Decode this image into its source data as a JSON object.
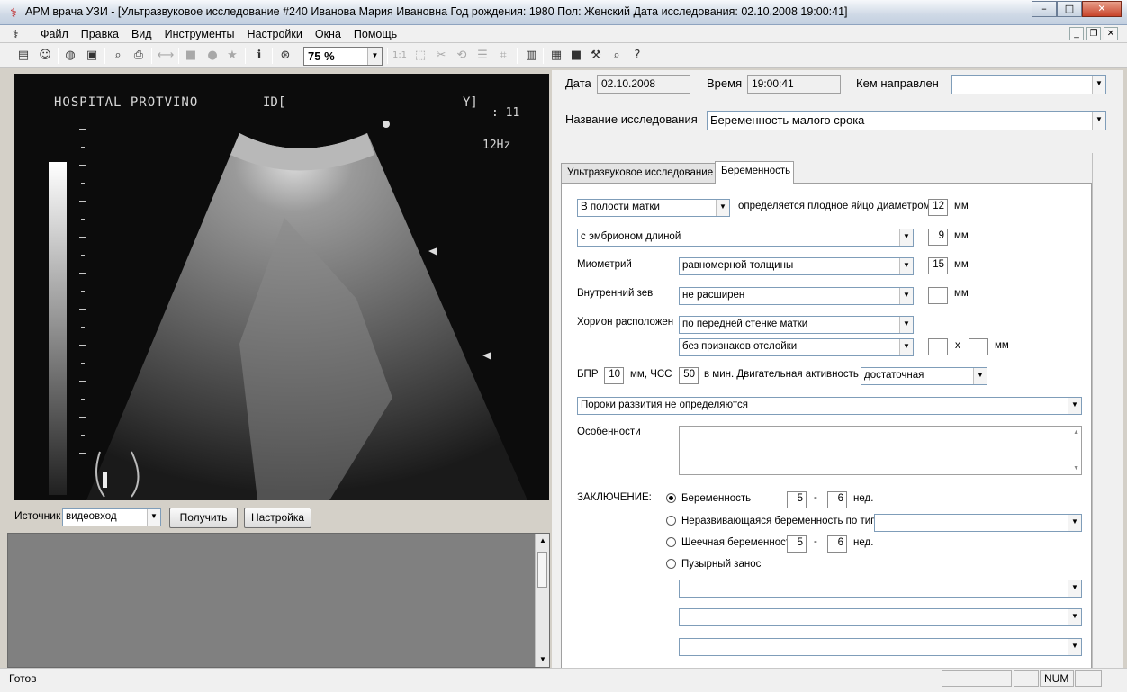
{
  "window": {
    "title": "АРМ врача УЗИ - [Ультразвуковое исследование #240 Иванова Мария Ивановна Год рождения: 1980 Пол: Женский Дата исследования: 02.10.2008 19:00:41]"
  },
  "menu": [
    "Файл",
    "Правка",
    "Вид",
    "Инструменты",
    "Настройки",
    "Окна",
    "Помощь"
  ],
  "toolbar": {
    "zoom_value": "75 %",
    "scale_label": "1:1"
  },
  "ultrasound": {
    "header_left": "HOSPITAL PROTVINO",
    "header_mid": "ID[",
    "header_right": "Y]",
    "time_text": ": 11",
    "freq_text": "12Hz"
  },
  "source": {
    "label": "Источник",
    "value": "видеовход",
    "get_button": "Получить",
    "settings_button": "Настройка"
  },
  "header": {
    "date_label": "Дата",
    "date_value": "02.10.2008",
    "time_label": "Время",
    "time_value": "19:00:41",
    "referred_label": "Кем направлен",
    "referred_value": "",
    "exam_name_label": "Название исследования",
    "exam_name_value": "Беременность малого срока"
  },
  "tabs": [
    {
      "label": "Ультразвуковое исследование"
    },
    {
      "label": "Беременность"
    }
  ],
  "form": {
    "location": "В полости матки",
    "egg_text": "определяется плодное яйцо диаметром",
    "egg_value": "12",
    "unit_mm": "мм",
    "embryo": "с эмбрионом длиной",
    "embryo_value": "9",
    "myometrium_label": "Миометрий",
    "myometrium": "равномерной толщины",
    "myometrium_value": "15",
    "os_label": "Внутренний зев",
    "os": "не расширен",
    "os_value": "",
    "chorion_label": "Хорион расположен",
    "chorion_location": "по передней стенке матки",
    "chorion_detach": "без признаков отслойки",
    "x_label": "х",
    "bpr_label": "БПР",
    "bpr_value": "10",
    "hr_label": "мм, ЧСС",
    "hr_value": "50",
    "motor_label": "в мин. Двигательная активность",
    "motor_value": "достаточная",
    "defects": "Пороки развития не определяются",
    "features_label": "Особенности",
    "conclusion_label": "ЗАКЛЮЧЕНИЕ:",
    "weeks_unit": "нед.",
    "dash": "-",
    "options": [
      {
        "label": "Беременность",
        "from": "5",
        "to": "6",
        "selected": true
      },
      {
        "label": "Неразвивающаяся беременность по типу",
        "selected": false
      },
      {
        "label": "Шеечная беременность",
        "from": "5",
        "to": "6",
        "selected": false
      },
      {
        "label": "Пузырный занос",
        "selected": false
      }
    ]
  },
  "status": {
    "ready": "Готов",
    "num": "NUM"
  }
}
